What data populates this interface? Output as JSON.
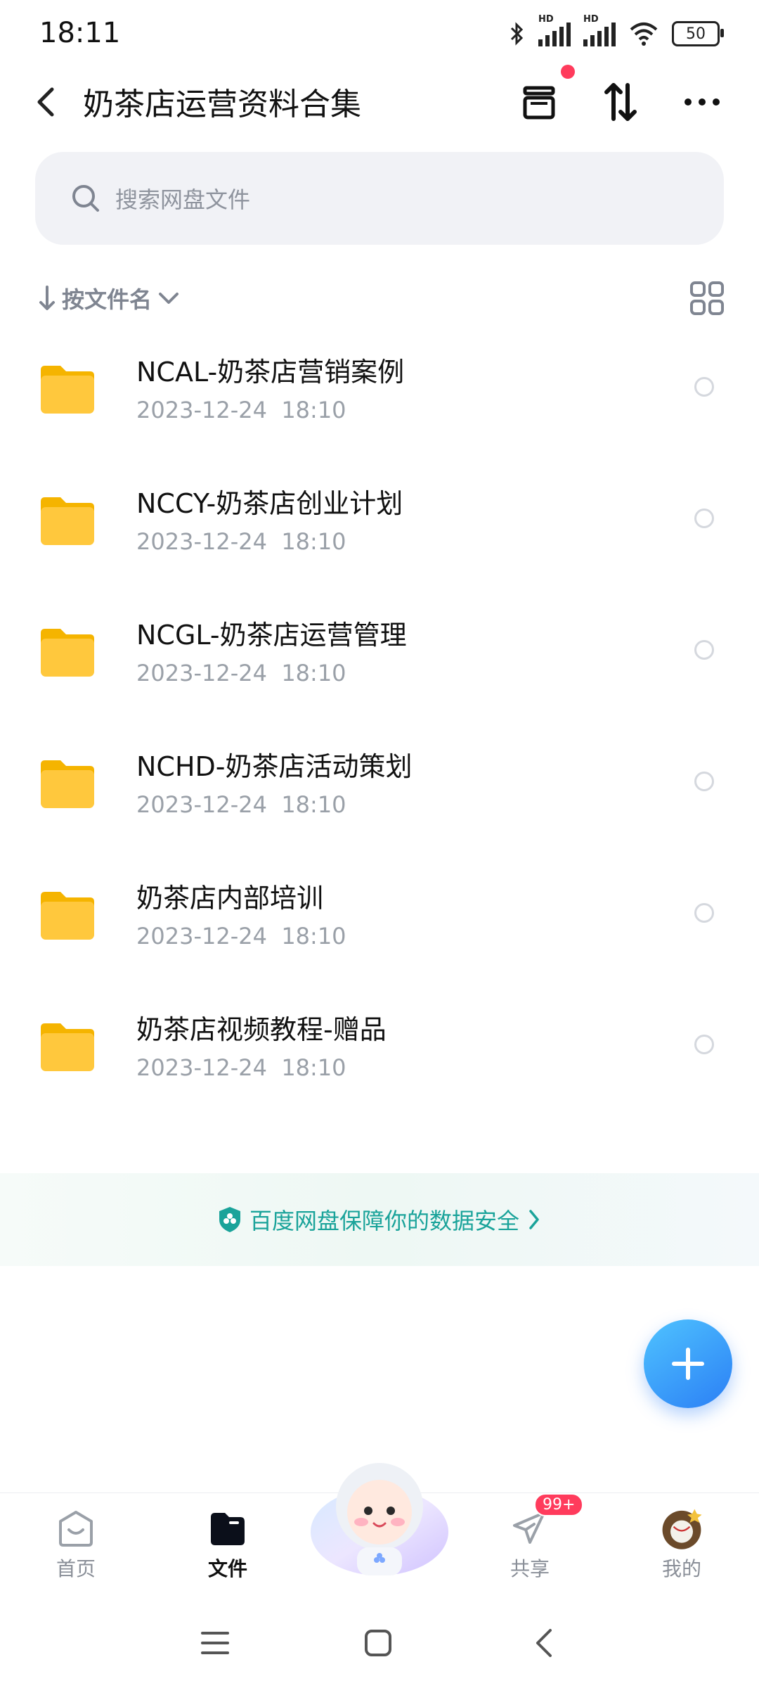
{
  "status_bar": {
    "time": "18:11",
    "network_label": "HD",
    "battery": "50"
  },
  "header": {
    "title": "奶茶店运营资料合集"
  },
  "search": {
    "placeholder": "搜索网盘文件"
  },
  "sort": {
    "label": "按文件名"
  },
  "files": [
    {
      "name": "NCAL-奶茶店营销案例",
      "date": "2023-12-24",
      "time": "18:10"
    },
    {
      "name": "NCCY-奶茶店创业计划",
      "date": "2023-12-24",
      "time": "18:10"
    },
    {
      "name": "NCGL-奶茶店运营管理",
      "date": "2023-12-24",
      "time": "18:10"
    },
    {
      "name": "NCHD-奶茶店活动策划",
      "date": "2023-12-24",
      "time": "18:10"
    },
    {
      "name": "奶茶店内部培训",
      "date": "2023-12-24",
      "time": "18:10"
    },
    {
      "name": "奶茶店视频教程-赠品",
      "date": "2023-12-24",
      "time": "18:10"
    }
  ],
  "security_banner": {
    "text": "百度网盘保障你的数据安全"
  },
  "bottom_nav": {
    "home": "首页",
    "files": "文件",
    "share": "共享",
    "share_badge": "99+",
    "me": "我的"
  },
  "colors": {
    "accent": "#2b7ff5",
    "security": "#1aa39a",
    "badge": "#ff3b5c",
    "folder": "#ffc83d"
  }
}
